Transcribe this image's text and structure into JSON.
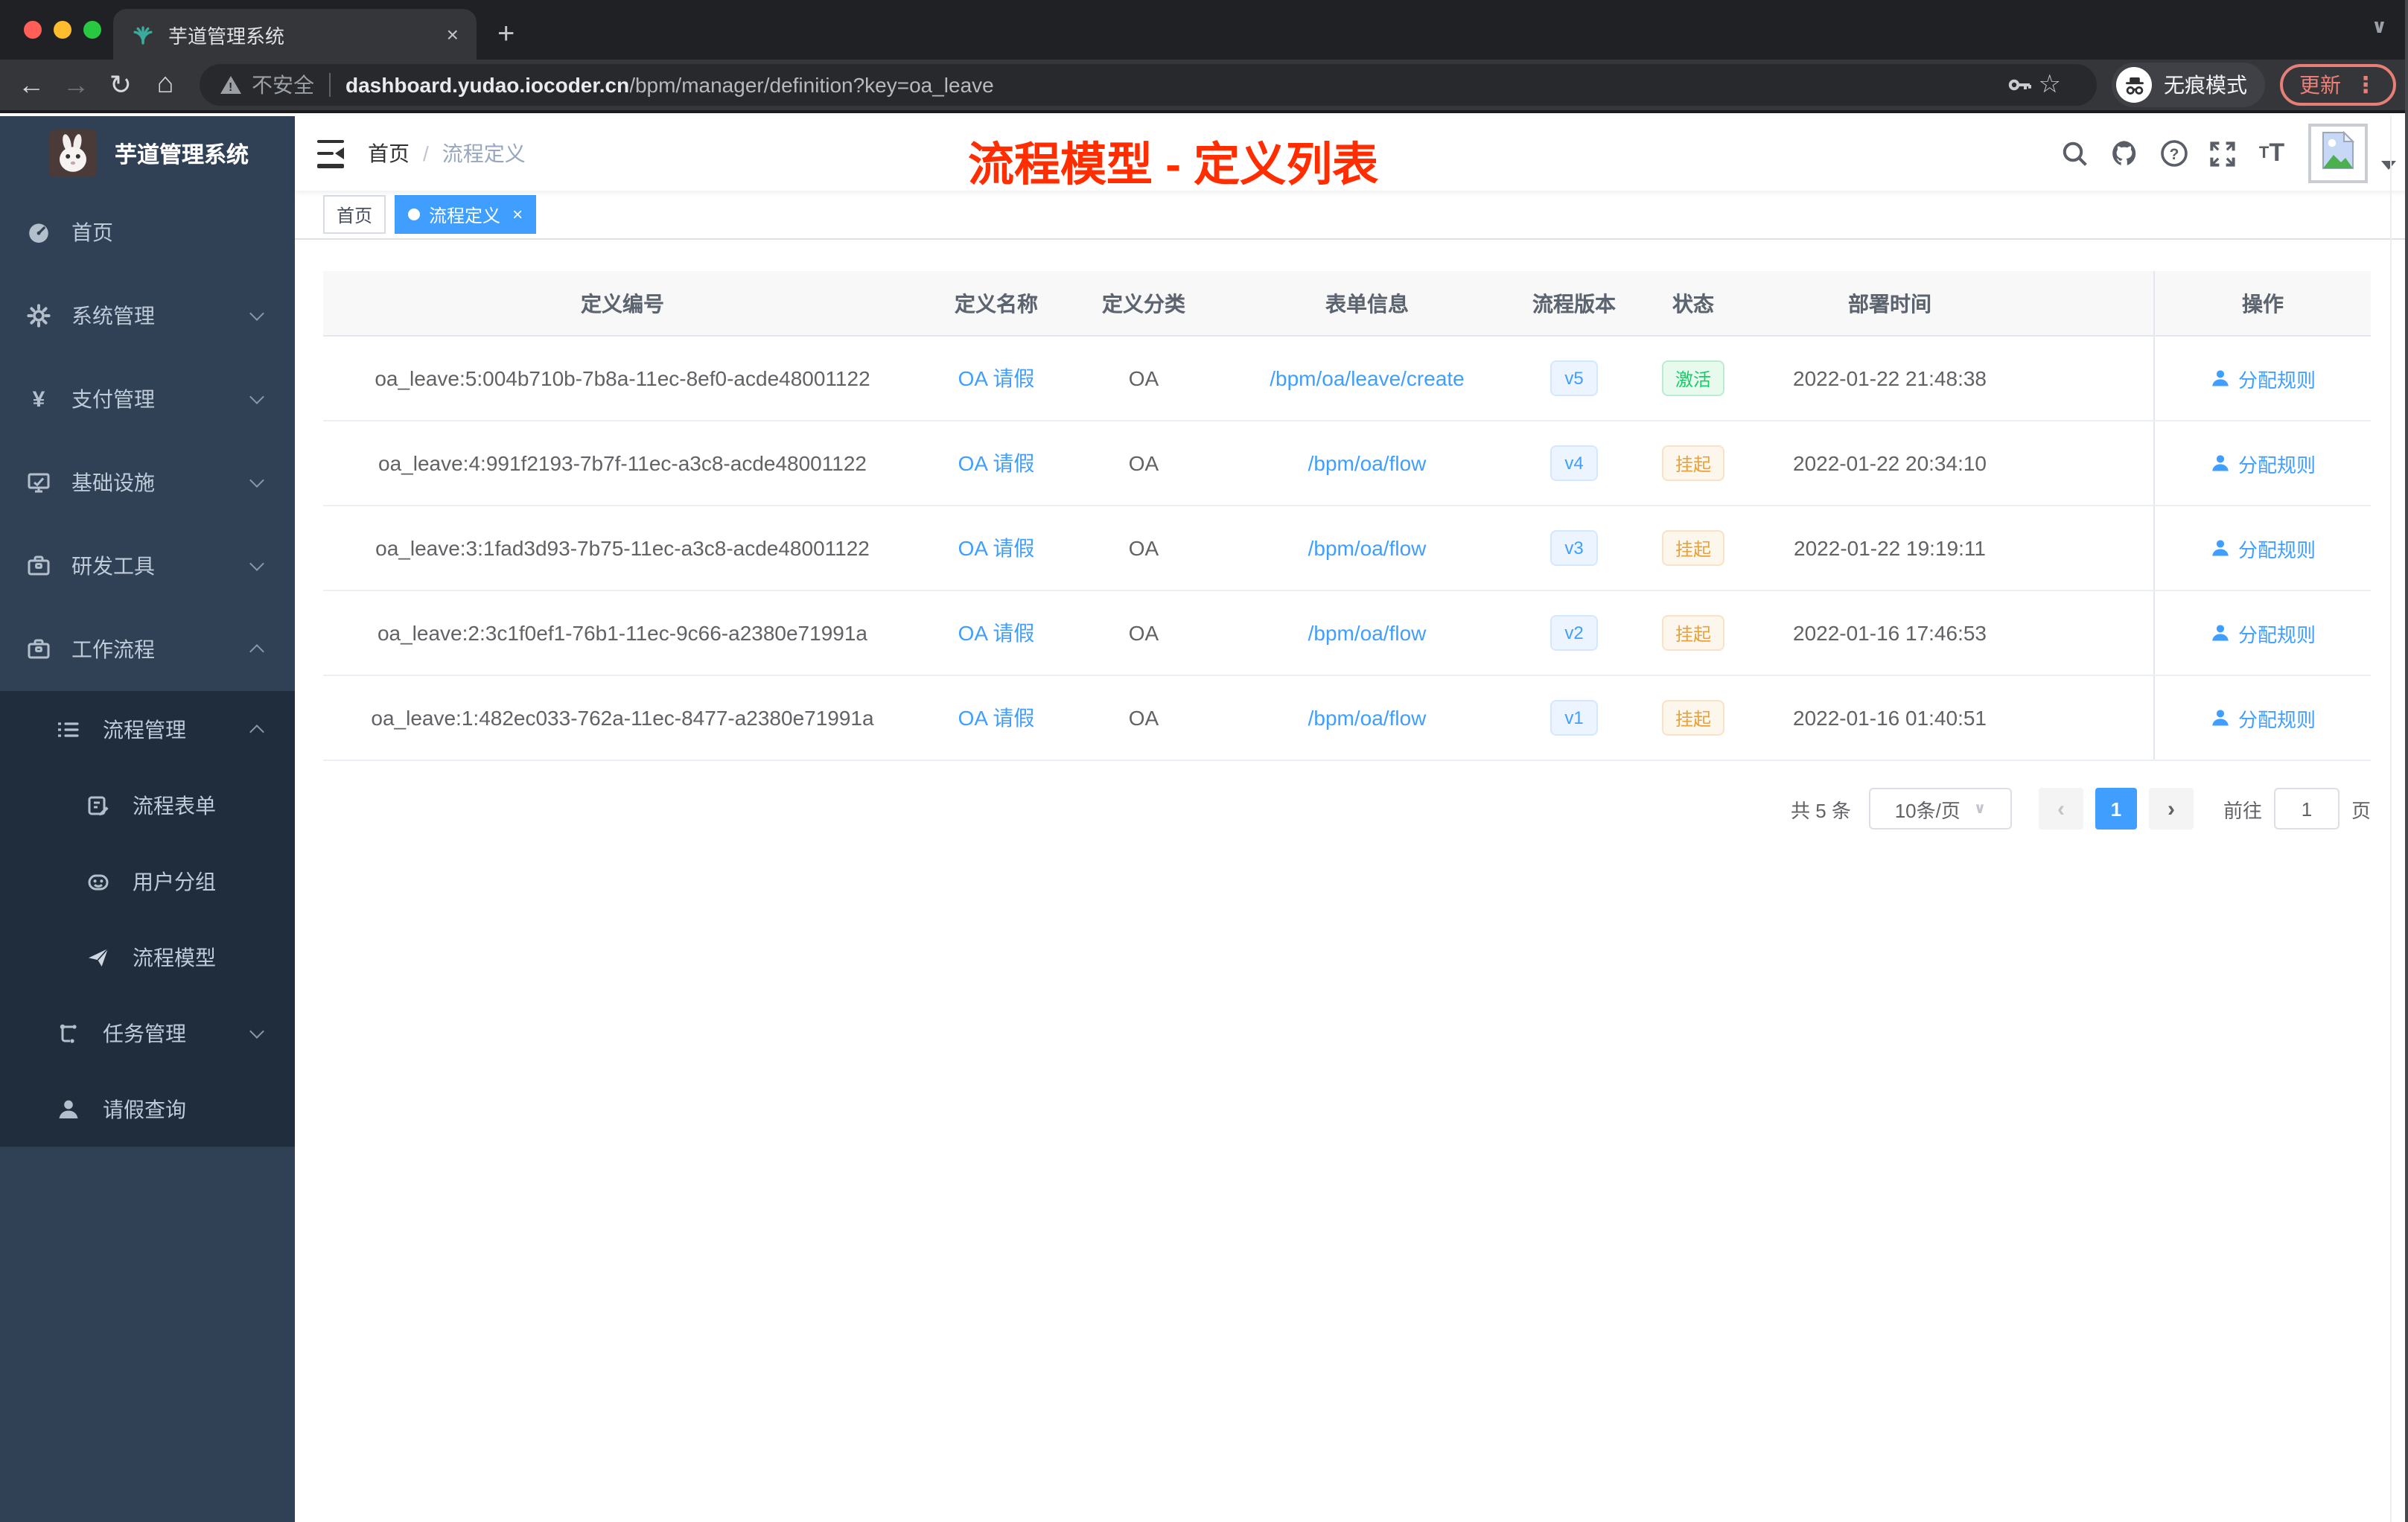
{
  "browser": {
    "tab_title": "芋道管理系统",
    "security_label": "不安全",
    "url_domain": "dashboard.yudao.iocoder.cn",
    "url_path": "/bpm/manager/definition?key=oa_leave",
    "incognito_label": "无痕模式",
    "update_label": "更新"
  },
  "sidebar": {
    "title": "芋道管理系统",
    "items": [
      {
        "label": "首页",
        "icon": "dashboard-icon"
      },
      {
        "label": "系统管理",
        "icon": "gear-icon"
      },
      {
        "label": "支付管理",
        "icon": "yen-icon"
      },
      {
        "label": "基础设施",
        "icon": "monitor-icon"
      },
      {
        "label": "研发工具",
        "icon": "toolbox-icon"
      },
      {
        "label": "工作流程",
        "icon": "toolbox-icon"
      },
      {
        "label": "流程管理",
        "icon": "list-icon"
      },
      {
        "label": "流程表单",
        "icon": "form-icon"
      },
      {
        "label": "用户分组",
        "icon": "robot-icon"
      },
      {
        "label": "流程模型",
        "icon": "paper-plane-icon"
      },
      {
        "label": "任务管理",
        "icon": "tree-icon"
      },
      {
        "label": "请假查询",
        "icon": "user-icon"
      }
    ]
  },
  "header": {
    "breadcrumb": [
      "首页",
      "流程定义"
    ],
    "annotation": "流程模型 - 定义列表"
  },
  "tags": [
    {
      "label": "首页"
    },
    {
      "label": "流程定义"
    }
  ],
  "table": {
    "columns": [
      "定义编号",
      "定义名称",
      "定义分类",
      "表单信息",
      "流程版本",
      "状态",
      "部署时间",
      "操作"
    ],
    "rows": [
      {
        "id": "oa_leave:5:004b710b-7b8a-11ec-8ef0-acde48001122",
        "name": "OA 请假",
        "category": "OA",
        "form": "/bpm/oa/leave/create",
        "version": "v5",
        "status": "激活",
        "time": "2022-01-22 21:48:38",
        "action": "分配规则"
      },
      {
        "id": "oa_leave:4:991f2193-7b7f-11ec-a3c8-acde48001122",
        "name": "OA 请假",
        "category": "OA",
        "form": "/bpm/oa/flow",
        "version": "v4",
        "status": "挂起",
        "time": "2022-01-22 20:34:10",
        "action": "分配规则"
      },
      {
        "id": "oa_leave:3:1fad3d93-7b75-11ec-a3c8-acde48001122",
        "name": "OA 请假",
        "category": "OA",
        "form": "/bpm/oa/flow",
        "version": "v3",
        "status": "挂起",
        "time": "2022-01-22 19:19:11",
        "action": "分配规则"
      },
      {
        "id": "oa_leave:2:3c1f0ef1-76b1-11ec-9c66-a2380e71991a",
        "name": "OA 请假",
        "category": "OA",
        "form": "/bpm/oa/flow",
        "version": "v2",
        "status": "挂起",
        "time": "2022-01-16 17:46:53",
        "action": "分配规则"
      },
      {
        "id": "oa_leave:1:482ec033-762a-11ec-8477-a2380e71991a",
        "name": "OA 请假",
        "category": "OA",
        "form": "/bpm/oa/flow",
        "version": "v1",
        "status": "挂起",
        "time": "2022-01-16 01:40:51",
        "action": "分配规则"
      }
    ]
  },
  "pagination": {
    "total": "共 5 条",
    "page_size": "10条/页",
    "current": "1",
    "goto_label": "前往",
    "goto_value": "1",
    "unit": "页"
  },
  "icons": {
    "back": "←",
    "forward": "→",
    "reload": "↻",
    "home": "⌂",
    "star": "☆",
    "tab_close": "×",
    "new_tab": "+",
    "tab_search": "∨",
    "menu_dots": "⋮",
    "breadcrumb_sep": "/",
    "select_caret": "∨",
    "prev": "‹",
    "next": "›",
    "tag_close": "×",
    "warning_bang": "!"
  },
  "colors": {
    "accent": "#409eff",
    "success": "#13ce66",
    "warning": "#e6a23c",
    "annotation": "#ff2d00",
    "sidebar": "#304156",
    "submenu": "#1f2d3d",
    "chrome_dark": "#35363a",
    "update_badge": "#ec8078"
  }
}
